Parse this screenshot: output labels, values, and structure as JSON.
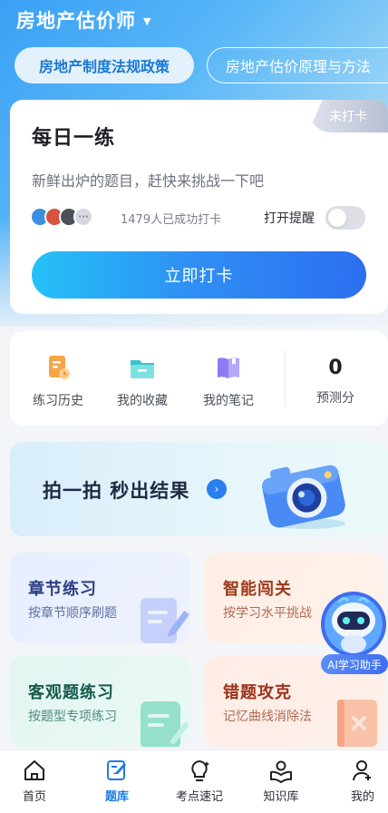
{
  "header": {
    "title": "房地产估价师"
  },
  "tabs": [
    {
      "label": "房地产制度法规政策",
      "active": true
    },
    {
      "label": "房地产估价原理与方法",
      "active": false
    }
  ],
  "daily": {
    "badge": "未打卡",
    "title": "每日一练",
    "subtitle": "新鲜出炉的题目，赶快来挑战一下吧",
    "avatar_more": "···",
    "count_text": "1479人已成功打卡",
    "remind_label": "打开提醒",
    "remind_on": false,
    "button_label": "立即打卡"
  },
  "quick": {
    "items": [
      {
        "label": "练习历史",
        "icon": "history-icon"
      },
      {
        "label": "我的收藏",
        "icon": "folder-icon"
      },
      {
        "label": "我的笔记",
        "icon": "notebook-icon"
      }
    ],
    "score_value": "0",
    "score_label": "预测分"
  },
  "banner": {
    "text": "拍一拍 秒出结果",
    "arrow": "›"
  },
  "cards": [
    {
      "title": "章节练习",
      "subtitle": "按章节顺序刷题"
    },
    {
      "title": "智能闯关",
      "subtitle": "按学习水平挑战"
    },
    {
      "title": "客观题练习",
      "subtitle": "按题型专项练习"
    },
    {
      "title": "错题攻克",
      "subtitle": "记忆曲线消除法"
    }
  ],
  "ai_assistant": {
    "label": "AI学习助手"
  },
  "nav": [
    {
      "label": "首页",
      "active": false,
      "icon": "home-icon"
    },
    {
      "label": "题库",
      "active": true,
      "icon": "question-bank-icon"
    },
    {
      "label": "考点速记",
      "active": false,
      "icon": "lightbulb-icon"
    },
    {
      "label": "知识库",
      "active": false,
      "icon": "knowledge-icon"
    },
    {
      "label": "我的",
      "active": false,
      "icon": "user-icon"
    }
  ],
  "colors": {
    "accent": "#1f7be8",
    "button_gradient_start": "#25c1f7",
    "button_gradient_end": "#2c6ff0"
  }
}
